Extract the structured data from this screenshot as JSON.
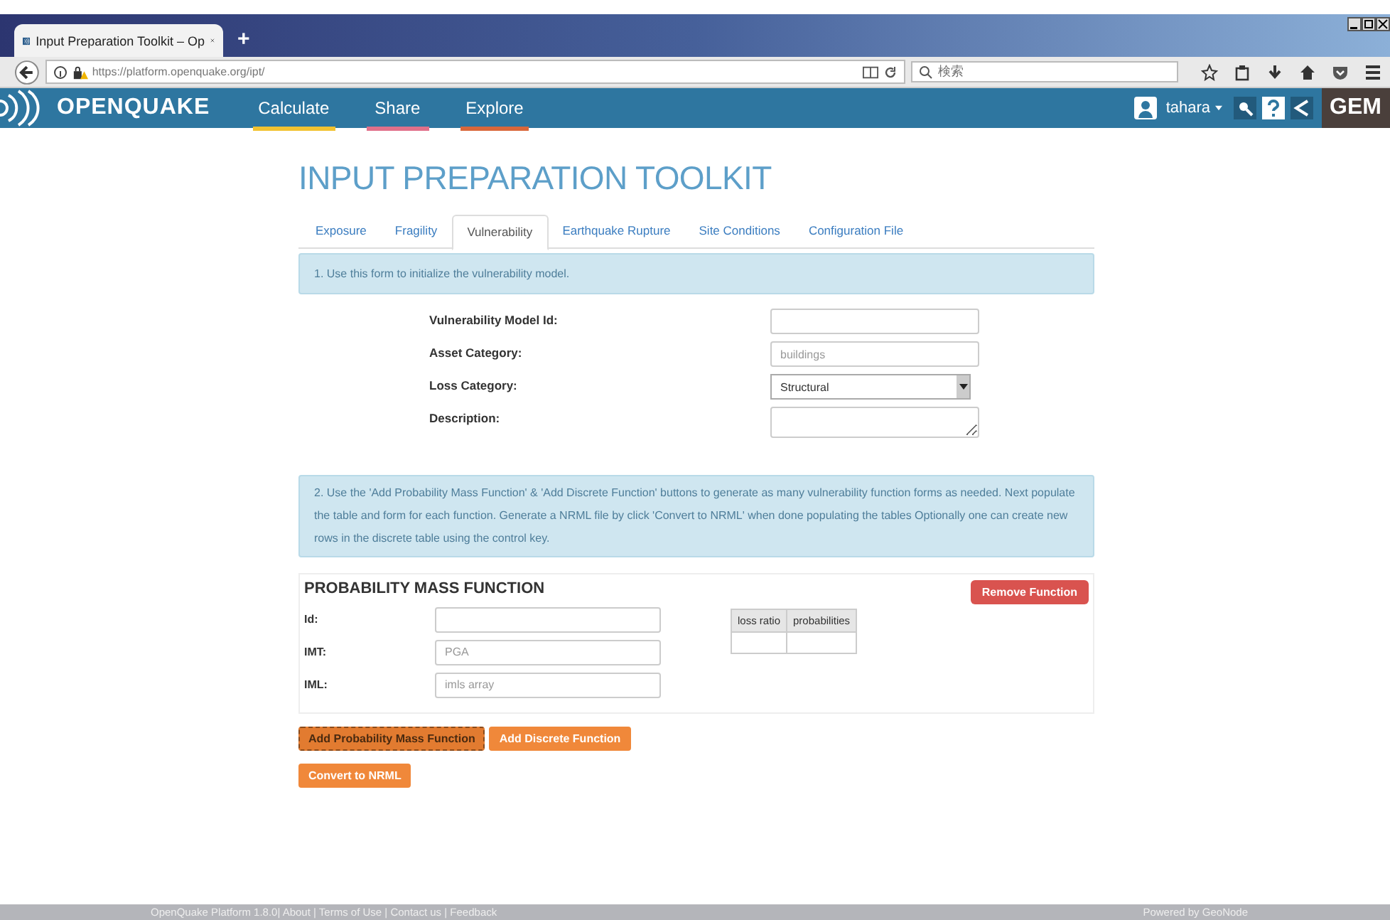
{
  "browser": {
    "tab_title": "Input Preparation Toolkit – Op",
    "new_tab": "+",
    "url": "https://platform.openquake.org/ipt/",
    "search_placeholder": "検索"
  },
  "nav": {
    "logo": "OPENQUAKE",
    "items": [
      {
        "label": "Calculate",
        "color": "#f2c230"
      },
      {
        "label": "Share",
        "color": "#e0708a"
      },
      {
        "label": "Explore",
        "color": "#d9673a"
      }
    ],
    "user": "tahara",
    "brand": "GEM"
  },
  "title": "INPUT PREPARATION TOOLKIT",
  "tabs": [
    {
      "label": "Exposure",
      "selected": false
    },
    {
      "label": "Fragility",
      "selected": false
    },
    {
      "label": "Vulnerability",
      "selected": true
    },
    {
      "label": "Earthquake Rupture",
      "selected": false
    },
    {
      "label": "Site Conditions",
      "selected": false
    },
    {
      "label": "Configuration File",
      "selected": false
    }
  ],
  "info_1": "1. Use this form to initialize the vulnerability model.",
  "fields": [
    {
      "label": "Vulnerability Model Id:",
      "kind": "text"
    },
    {
      "label": "Asset Category:",
      "kind": "text",
      "placeholder": "buildings"
    },
    {
      "label": "Loss Category:",
      "kind": "select",
      "value": "Structural"
    },
    {
      "label": "Description:",
      "kind": "textarea"
    }
  ],
  "info_2": "2. Use the 'Add Probability Mass Function' & 'Add Discrete Function' buttons to generate as many vulnerability function forms as needed. Next populate the table and form for each function. Generate a NRML file by click 'Convert to NRML' when done populating the tables Optionally one can create new rows in the discrete table using the control key.",
  "function": {
    "title": "PROBABILITY MASS FUNCTION",
    "remove_button": "Remove Function",
    "fields": [
      {
        "label": "Id:"
      },
      {
        "label": "IMT:",
        "placeholder": "PGA"
      },
      {
        "label": "IML:",
        "placeholder": "imls array"
      }
    ],
    "table": {
      "columns": [
        "loss ratio",
        "probabilities"
      ]
    }
  },
  "add_buttons": [
    {
      "label": "Add Probability Mass Function",
      "selected": true
    },
    {
      "label": "Add Discrete Function",
      "selected": false
    }
  ],
  "convert_button": "Convert to NRML",
  "footer": {
    "left": "OpenQuake Platform 1.8.0| About | Terms of Use | Contact us | Feedback",
    "right": "Powered by GeoNode"
  }
}
